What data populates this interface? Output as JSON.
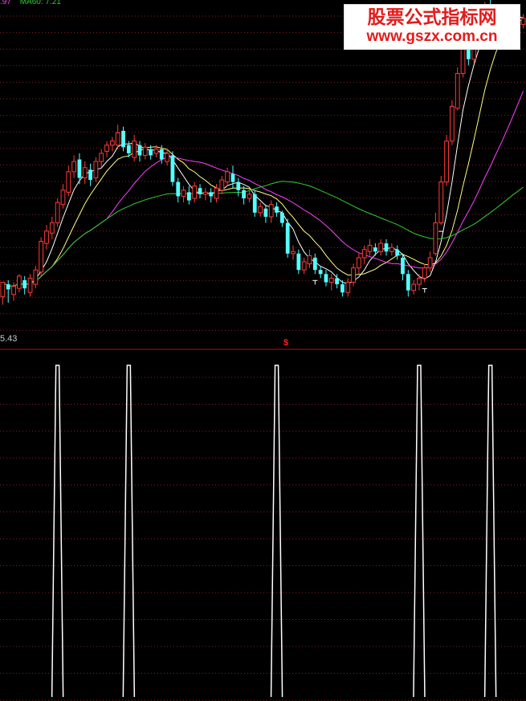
{
  "legend": {
    "ma_fragment": ".97",
    "ma60_label": "MA60: 7.21"
  },
  "price_low_label": "5.43",
  "mid_marker": "$",
  "watermark": {
    "title": "股票公式指标网",
    "url": "www.gszx.com.cn"
  },
  "colors": {
    "background": "#000000",
    "up": "#ff3b3b",
    "down": "#54ffff",
    "ma_short": "#ffffff",
    "ma_mid": "#ffff80",
    "ma_long": "#ff40ff",
    "ma60": "#33cc33",
    "grid": "#8a1f1f",
    "signal": "#ffffff",
    "divider": "#b01010"
  },
  "chart_data": [
    {
      "type": "candlestick",
      "title": "",
      "price_range": [
        5.3,
        8.4
      ],
      "series": [
        {
          "name": "MA60",
          "legend_value": 7.21
        },
        {
          "name": "",
          "description": "short moving average (white)"
        },
        {
          "name": "",
          "description": "medium moving average (yellow)"
        },
        {
          "name": "",
          "description": "long moving average (magenta)"
        }
      ],
      "candles": [
        [
          5.58,
          5.72,
          5.5,
          5.7
        ],
        [
          5.7,
          5.65,
          5.52,
          5.74
        ],
        [
          5.6,
          5.68,
          5.54,
          5.72
        ],
        [
          5.66,
          5.78,
          5.62,
          5.8
        ],
        [
          5.74,
          5.66,
          5.6,
          5.78
        ],
        [
          5.62,
          5.76,
          5.58,
          5.8
        ],
        [
          5.7,
          5.84,
          5.66,
          5.88
        ],
        [
          5.82,
          6.12,
          5.78,
          6.16
        ],
        [
          6.1,
          6.22,
          6.04,
          6.28
        ],
        [
          6.2,
          6.3,
          6.14,
          6.36
        ],
        [
          6.3,
          6.5,
          6.26,
          6.54
        ],
        [
          6.48,
          6.62,
          6.44,
          6.68
        ],
        [
          6.6,
          6.8,
          6.56,
          6.86
        ],
        [
          6.8,
          6.9,
          6.74,
          6.96
        ],
        [
          6.92,
          6.74,
          6.68,
          6.98
        ],
        [
          6.74,
          6.84,
          6.68,
          6.9
        ],
        [
          6.82,
          6.72,
          6.66,
          6.88
        ],
        [
          6.74,
          6.9,
          6.7,
          6.94
        ],
        [
          6.9,
          6.98,
          6.84,
          7.02
        ],
        [
          7.0,
          7.06,
          6.94,
          7.1
        ],
        [
          7.06,
          7.1,
          7.0,
          7.14
        ],
        [
          7.06,
          7.18,
          7.02,
          7.26
        ],
        [
          7.2,
          7.04,
          7.0,
          7.24
        ],
        [
          7.06,
          6.98,
          6.94,
          7.1
        ],
        [
          6.94,
          7.1,
          6.9,
          7.16
        ],
        [
          7.06,
          6.96,
          6.9,
          7.1
        ],
        [
          6.96,
          7.04,
          6.92,
          7.08
        ],
        [
          7.02,
          6.96,
          6.92,
          7.06
        ],
        [
          6.98,
          7.02,
          6.94,
          7.06
        ],
        [
          7.02,
          6.92,
          6.88,
          7.06
        ],
        [
          6.9,
          6.98,
          6.86,
          7.02
        ],
        [
          6.96,
          6.7,
          6.66,
          7.0
        ],
        [
          6.7,
          6.56,
          6.5,
          6.74
        ],
        [
          6.56,
          6.62,
          6.5,
          6.66
        ],
        [
          6.6,
          6.52,
          6.48,
          6.66
        ],
        [
          6.54,
          6.66,
          6.5,
          6.7
        ],
        [
          6.64,
          6.58,
          6.54,
          6.68
        ],
        [
          6.58,
          6.6,
          6.52,
          6.64
        ],
        [
          6.6,
          6.56,
          6.5,
          6.64
        ],
        [
          6.54,
          6.64,
          6.5,
          6.68
        ],
        [
          6.62,
          6.72,
          6.58,
          6.76
        ],
        [
          6.7,
          6.8,
          6.66,
          6.84
        ],
        [
          6.78,
          6.7,
          6.64,
          6.86
        ],
        [
          6.7,
          6.62,
          6.56,
          6.74
        ],
        [
          6.62,
          6.54,
          6.48,
          6.66
        ],
        [
          6.54,
          6.58,
          6.5,
          6.62
        ],
        [
          6.58,
          6.4,
          6.36,
          6.62
        ],
        [
          6.4,
          6.46,
          6.36,
          6.5
        ],
        [
          6.44,
          6.36,
          6.3,
          6.48
        ],
        [
          6.36,
          6.48,
          6.3,
          6.52
        ],
        [
          6.46,
          6.4,
          6.36,
          6.5
        ],
        [
          6.4,
          6.3,
          6.26,
          6.42
        ],
        [
          6.3,
          6.0,
          5.96,
          6.34
        ],
        [
          6.0,
          6.02,
          5.94,
          6.08
        ],
        [
          6.0,
          5.84,
          5.8,
          6.04
        ],
        [
          5.84,
          5.92,
          5.8,
          5.96
        ],
        [
          5.9,
          5.98,
          5.86,
          6.04
        ],
        [
          5.96,
          5.84,
          5.8,
          6.0
        ],
        [
          5.84,
          5.8,
          5.76,
          5.88
        ],
        [
          5.8,
          5.72,
          5.68,
          5.84
        ],
        [
          5.72,
          5.76,
          5.64,
          5.8
        ],
        [
          5.76,
          5.7,
          5.66,
          5.8
        ],
        [
          5.7,
          5.62,
          5.58,
          5.74
        ],
        [
          5.62,
          5.72,
          5.58,
          5.76
        ],
        [
          5.72,
          5.86,
          5.68,
          5.9
        ],
        [
          5.86,
          5.96,
          5.8,
          6.0
        ],
        [
          5.96,
          6.04,
          5.9,
          6.08
        ],
        [
          6.02,
          6.08,
          5.98,
          6.14
        ],
        [
          6.06,
          6.02,
          5.98,
          6.1
        ],
        [
          6.02,
          6.1,
          5.98,
          6.14
        ],
        [
          6.1,
          6.02,
          5.98,
          6.14
        ],
        [
          6.02,
          6.06,
          5.98,
          6.1
        ],
        [
          6.04,
          5.98,
          5.94,
          6.08
        ],
        [
          5.96,
          5.8,
          5.74,
          6.0
        ],
        [
          5.8,
          5.64,
          5.58,
          5.84
        ],
        [
          5.64,
          5.7,
          5.6,
          5.74
        ],
        [
          5.7,
          5.76,
          5.64,
          5.8
        ],
        [
          5.76,
          5.86,
          5.72,
          5.9
        ],
        [
          5.86,
          5.96,
          5.82,
          6.02
        ],
        [
          6.0,
          6.3,
          5.98,
          6.4
        ],
        [
          6.3,
          6.7,
          6.28,
          6.76
        ],
        [
          6.7,
          7.1,
          6.66,
          7.16
        ],
        [
          7.1,
          7.44,
          7.06,
          7.5
        ],
        [
          7.42,
          7.76,
          7.4,
          7.82
        ],
        [
          7.76,
          8.02,
          7.72,
          8.08
        ],
        [
          8.0,
          7.9,
          7.84,
          8.06
        ],
        [
          7.9,
          8.1,
          7.86,
          8.16
        ],
        [
          8.1,
          8.3,
          8.06,
          8.36
        ],
        [
          8.3,
          8.4,
          8.26,
          8.46
        ],
        [
          8.4,
          8.3,
          8.2,
          8.48
        ],
        [
          8.3,
          8.36,
          8.24,
          8.42
        ],
        [
          8.36,
          8.3,
          8.24,
          8.4
        ],
        [
          8.3,
          8.38,
          8.24,
          8.44
        ],
        [
          8.38,
          8.3,
          8.24,
          8.42
        ],
        [
          8.3,
          8.24,
          8.18,
          8.36
        ],
        [
          8.24,
          8.3,
          8.2,
          8.34
        ]
      ],
      "trade_markers": [
        {
          "index": 80,
          "kind": "dash"
        },
        {
          "index": 77,
          "kind": "T"
        },
        {
          "index": 57,
          "kind": "T"
        }
      ]
    },
    {
      "type": "line",
      "title": "",
      "ylim": [
        0,
        1
      ],
      "spikes": [
        {
          "index": 10,
          "value": 1
        },
        {
          "index": 23,
          "value": 1
        },
        {
          "index": 50,
          "value": 1
        },
        {
          "index": 76,
          "value": 1
        },
        {
          "index": 89,
          "value": 1
        }
      ]
    }
  ]
}
